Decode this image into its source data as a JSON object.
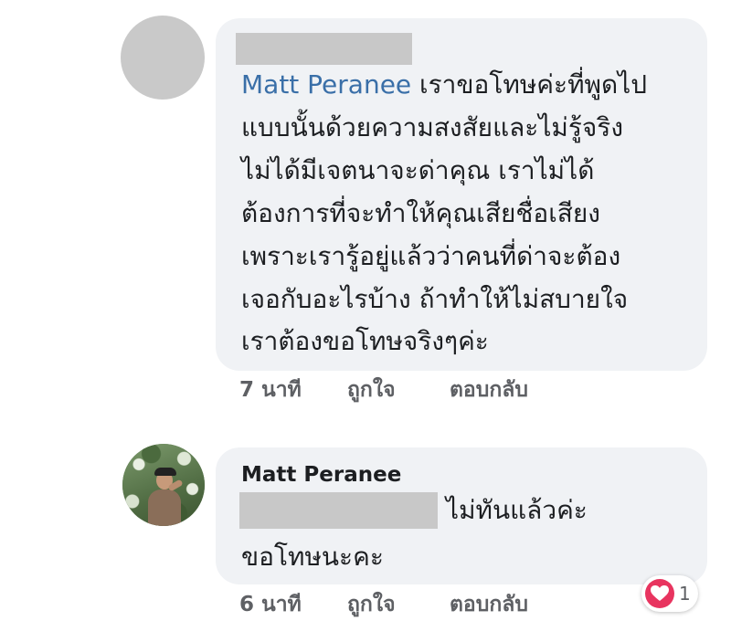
{
  "comments": [
    {
      "author_redacted": true,
      "mention": "Matt Peranee",
      "lines": [
        " เราขอโทษค่ะที่พูดไป",
        "แบบนั้นด้วยความสงสัยและไม่รู้จริง",
        "ไม่ได้มีเจตนาจะด่าคุณ เราไม่ได้",
        "ต้องการที่จะทำให้คุณเสียชื่อเสียง",
        "เพราะเรารู้อยู่แล้วว่าคนที่ด่าจะต้อง",
        "เจอกับอะไรบ้าง ถ้าทำให้ไม่สบายใจ",
        "เราต้องขอโทษจริงๆค่ะ"
      ],
      "time": "7 นาที",
      "like_label": "ถูกใจ",
      "reply_label": "ตอบกลับ"
    },
    {
      "author": "Matt Peranee",
      "lines": [
        "ไม่ทันแล้วค่ะ",
        "ขอโทษนะคะ"
      ],
      "time": "6 นาที",
      "like_label": "ถูกใจ",
      "reply_label": "ตอบกลับ",
      "reaction_icon": "heart-icon",
      "reaction_count": "1",
      "reaction_color": "#e8345f"
    }
  ]
}
